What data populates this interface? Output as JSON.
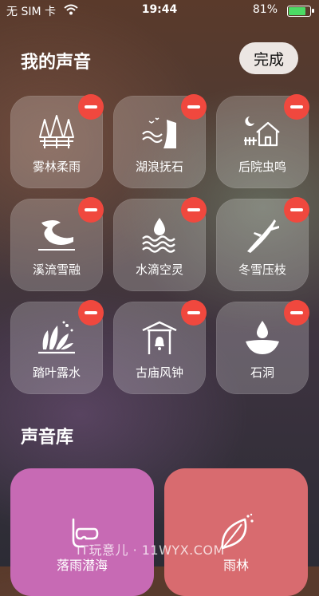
{
  "status_bar": {
    "carrier": "无 SIM 卡",
    "time": "19:44",
    "battery": "81%",
    "battery_level": 0.81
  },
  "header": {
    "title": "我的声音",
    "done_label": "完成"
  },
  "my_sounds": [
    {
      "label": "雾林柔雨",
      "icon": "foggy-forest-icon"
    },
    {
      "label": "湖浪抚石",
      "icon": "lake-waves-icon"
    },
    {
      "label": "后院虫鸣",
      "icon": "backyard-house-icon"
    },
    {
      "label": "溪流雪融",
      "icon": "stream-icon"
    },
    {
      "label": "水滴空灵",
      "icon": "water-drop-icon"
    },
    {
      "label": "冬雪压枝",
      "icon": "snow-branch-icon"
    },
    {
      "label": "踏叶露水",
      "icon": "leaves-dew-icon"
    },
    {
      "label": "古庙风钟",
      "icon": "temple-bell-icon"
    },
    {
      "label": "石洞",
      "icon": "cave-drop-icon"
    }
  ],
  "library": {
    "title": "声音库",
    "items": [
      {
        "label": "落雨潜海",
        "icon": "snorkel-icon",
        "color": "#c76ab4"
      },
      {
        "label": "雨林",
        "icon": "leaf-icon",
        "color": "#d86b6f"
      }
    ]
  },
  "watermark": "IT玩意儿 · 11WYX.COM"
}
